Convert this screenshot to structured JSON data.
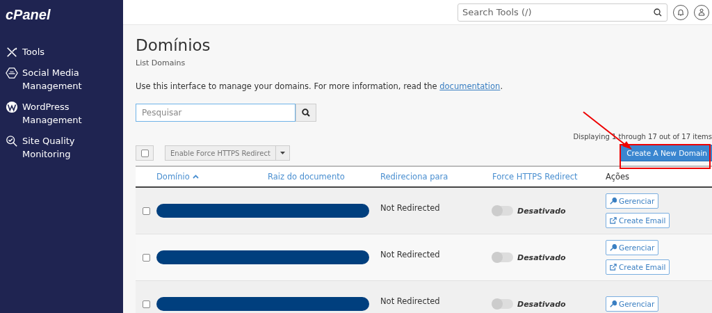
{
  "sidebar": {
    "logo": "cPanel",
    "items": [
      {
        "kind": "tools",
        "label": "Tools"
      },
      {
        "kind": "social",
        "label": "Social Media Management"
      },
      {
        "kind": "wordpress",
        "label": "WordPress Management"
      },
      {
        "kind": "quality",
        "label": "Site Quality Monitoring"
      }
    ]
  },
  "topbar": {
    "search": {
      "placeholder": "Search Tools (/)"
    }
  },
  "page": {
    "title": "Domínios",
    "subtitle": "List Domains",
    "description_text": "Use this interface to manage your domains. For more information, read the ",
    "description_link": "documentation",
    "description_end": "."
  },
  "filter": {
    "placeholder": "Pesquisar"
  },
  "toolbar": {
    "select_all_checked": false,
    "bulk_action": "Enable Force HTTPS Redirect",
    "paging": "Displaying 1 through 17 out of 17 items",
    "create_button": "Create A New Domain"
  },
  "table": {
    "columns": [
      {
        "label": "Domínio",
        "sortable": true,
        "sorted": true
      },
      {
        "label": "Raiz do documento",
        "sortable": true,
        "sorted": false
      },
      {
        "label": "Redireciona para",
        "sortable": true,
        "sorted": false
      },
      {
        "label": "Force HTTPS Redirect",
        "sortable": true,
        "sorted": false
      },
      {
        "label": "Ações",
        "sortable": false,
        "sorted": false
      }
    ],
    "rows": [
      {
        "checked": false,
        "redirect": "Not Redirected",
        "https_on": false,
        "https_label": "Desativado",
        "actions": [
          {
            "kind": "manage",
            "label": "Gerenciar"
          },
          {
            "kind": "email",
            "label": "Create Email"
          }
        ]
      },
      {
        "checked": false,
        "redirect": "Not Redirected",
        "https_on": false,
        "https_label": "Desativado",
        "actions": [
          {
            "kind": "manage",
            "label": "Gerenciar"
          },
          {
            "kind": "email",
            "label": "Create Email"
          }
        ]
      },
      {
        "checked": false,
        "redirect": "Not Redirected",
        "https_on": false,
        "https_label": "Desativado",
        "actions": [
          {
            "kind": "manage",
            "label": "Gerenciar"
          }
        ]
      }
    ]
  }
}
